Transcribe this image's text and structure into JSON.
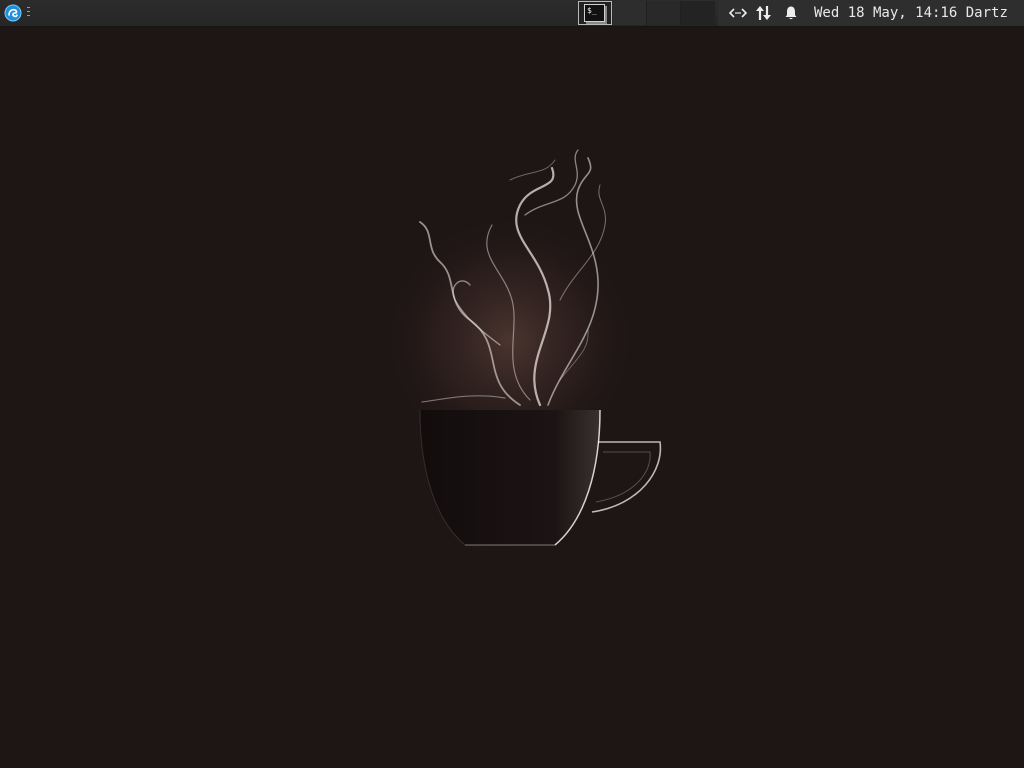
{
  "panel": {
    "launcher_icon": "app-menu-icon",
    "handle_icon": "panel-handle-icon",
    "taskbar": [
      {
        "name": "terminal",
        "icon": "terminal-icon",
        "active": true
      },
      {
        "name": "empty-task-2"
      },
      {
        "name": "empty-task-3"
      },
      {
        "name": "empty-task-4"
      }
    ],
    "tray": {
      "icons": [
        "network-code-icon",
        "network-transfer-icon",
        "bell-icon"
      ],
      "clock": "Wed 18 May, 14:16",
      "user": "Dartz"
    }
  },
  "wallpaper": {
    "subject": "steaming-coffee-cup-icon",
    "colors": {
      "background": "#1e1515",
      "steam": "#e8e2dc",
      "glow": "#5a4038"
    }
  }
}
